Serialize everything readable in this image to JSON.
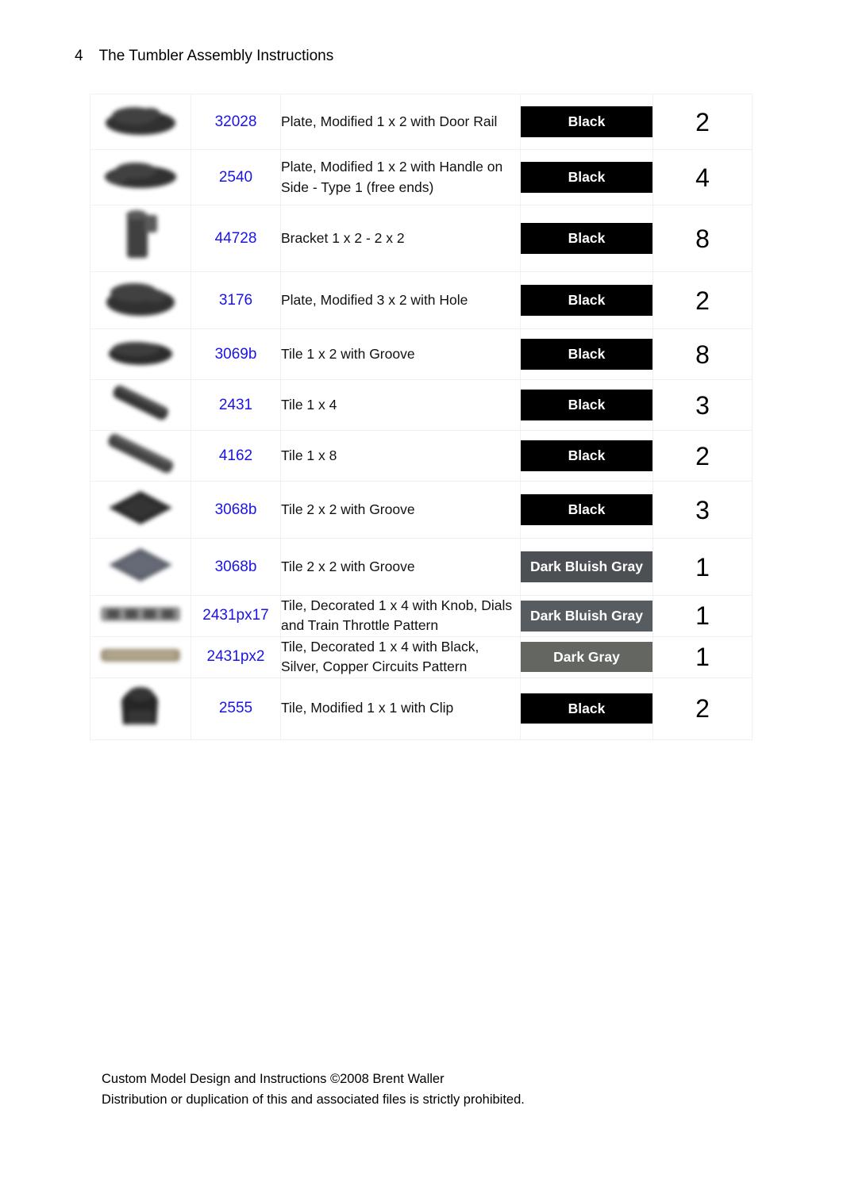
{
  "header": {
    "page_number": "4",
    "title": "The Tumbler Assembly Instructions"
  },
  "table": {
    "rows": [
      {
        "image": "plate-modified-1x2-door-rail-thumbnail",
        "part_number": "32028",
        "description": "Plate, Modified 1 x 2 with Door Rail",
        "color": "Black",
        "color_hex": "#000000",
        "quantity": "2"
      },
      {
        "image": "plate-modified-1x2-handle-on-side-thumbnail",
        "part_number": "2540",
        "description": "Plate, Modified 1 x 2 with Handle on Side - Type 1 (free ends)",
        "color": "Black",
        "color_hex": "#000000",
        "quantity": "4"
      },
      {
        "image": "bracket-1x2-2x2-thumbnail",
        "part_number": "44728",
        "description": "Bracket 1 x 2 - 2 x 2",
        "color": "Black",
        "color_hex": "#000000",
        "quantity": "8"
      },
      {
        "image": "plate-modified-3x2-with-hole-thumbnail",
        "part_number": "3176",
        "description": "Plate, Modified 3 x 2 with Hole",
        "color": "Black",
        "color_hex": "#000000",
        "quantity": "2"
      },
      {
        "image": "tile-1x2-with-groove-thumbnail",
        "part_number": "3069b",
        "description": "Tile 1 x 2 with Groove",
        "color": "Black",
        "color_hex": "#000000",
        "quantity": "8"
      },
      {
        "image": "tile-1x4-thumbnail",
        "part_number": "2431",
        "description": "Tile 1 x 4",
        "color": "Black",
        "color_hex": "#000000",
        "quantity": "3"
      },
      {
        "image": "tile-1x8-thumbnail",
        "part_number": "4162",
        "description": "Tile 1 x 8",
        "color": "Black",
        "color_hex": "#000000",
        "quantity": "2"
      },
      {
        "image": "tile-2x2-with-groove-black-thumbnail",
        "part_number": "3068b",
        "description": "Tile 2 x 2 with Groove",
        "color": "Black",
        "color_hex": "#000000",
        "quantity": "3"
      },
      {
        "image": "tile-2x2-with-groove-gray-thumbnail",
        "part_number": "3068b",
        "description": "Tile 2 x 2 with Groove",
        "color": "Dark Bluish Gray",
        "color_hex": "#4c5054",
        "quantity": "1"
      },
      {
        "image": "tile-decorated-1x4-train-throttle-thumbnail",
        "part_number": "2431px17",
        "description": "Tile, Decorated 1 x 4 with Knob, Dials and Train Throttle Pattern",
        "color": "Dark Bluish Gray",
        "color_hex": "#565c60",
        "quantity": "1"
      },
      {
        "image": "tile-decorated-1x4-copper-circuits-thumbnail",
        "part_number": "2431px2",
        "description": "Tile, Decorated 1 x 4 with Black, Silver, Copper Circuits Pattern",
        "color": "Dark Gray",
        "color_hex": "#646662",
        "quantity": "1"
      },
      {
        "image": "tile-modified-1x1-with-clip-thumbnail",
        "part_number": "2555",
        "description": "Tile, Modified 1 x 1 with Clip",
        "color": "Black",
        "color_hex": "#000000",
        "quantity": "2"
      }
    ]
  },
  "footer": {
    "line1": "Custom Model Design and Instructions ©2008 Brent Waller",
    "line2": "Distribution or duplication of this and associated files is strictly prohibited."
  },
  "colors": {
    "part_number_link": "#1a14e8",
    "grid_line": "#f0f0f0",
    "text": "#000000"
  }
}
